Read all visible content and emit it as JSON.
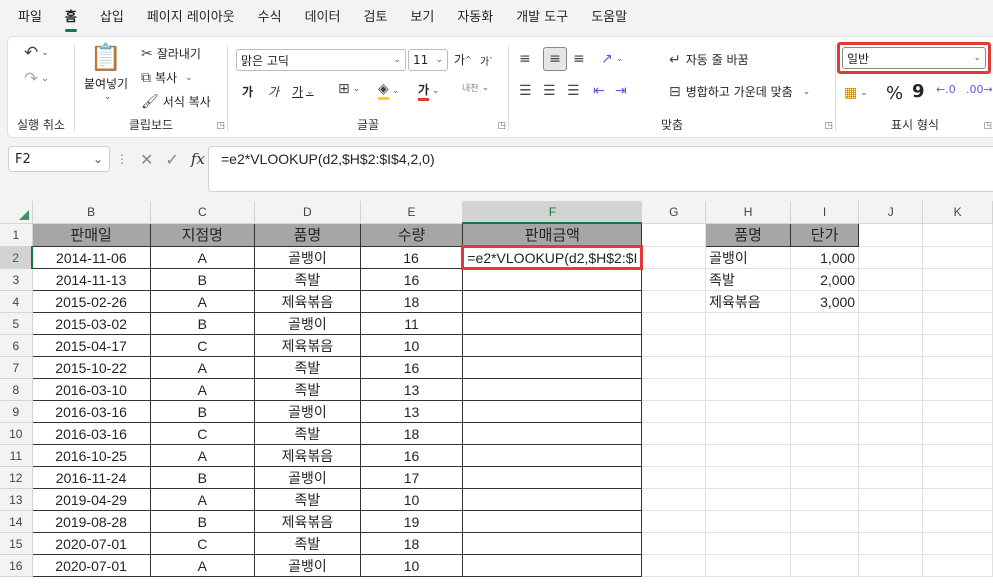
{
  "menu": {
    "tabs": [
      "파일",
      "홈",
      "삽입",
      "페이지 레이아웃",
      "수식",
      "데이터",
      "검토",
      "보기",
      "자동화",
      "개발 도구",
      "도움말"
    ],
    "active": "홈"
  },
  "ribbon": {
    "undo_label": "실행 취소",
    "clipboard": {
      "paste": "붙여넣기",
      "cut": "잘라내기",
      "copy": "복사",
      "format_painter": "서식 복사",
      "label": "클립보드"
    },
    "font": {
      "name": "맑은 고딕",
      "size": "11",
      "grow": "가",
      "shrink": "가",
      "bold": "가",
      "italic": "가",
      "underline": "가",
      "color_letter": "가",
      "phonetic": "내천",
      "label": "글꼴"
    },
    "alignment": {
      "wrap_text": "자동 줄 바꿈",
      "merge_center": "병합하고 가운데 맞춤",
      "label": "맞춤"
    },
    "number": {
      "format": "일반",
      "percent": "%",
      "comma": "9",
      "label": "표시 형식"
    }
  },
  "formula_bar": {
    "name_box": "F2",
    "fx": "fx",
    "formula": "=e2*VLOOKUP(d2,$H$2:$I$4,2,0)"
  },
  "sheet": {
    "columns": [
      "B",
      "C",
      "D",
      "E",
      "F",
      "G",
      "H",
      "I",
      "J",
      "K"
    ],
    "selected_column": "F",
    "selected_row": 2,
    "header_row": [
      "판매일",
      "지점명",
      "품명",
      "수량",
      "판매금액"
    ],
    "rows": [
      {
        "n": 2,
        "date": "2014-11-06",
        "branch": "A",
        "item": "골뱅이",
        "qty": "16"
      },
      {
        "n": 3,
        "date": "2014-11-13",
        "branch": "B",
        "item": "족발",
        "qty": "16"
      },
      {
        "n": 4,
        "date": "2015-02-26",
        "branch": "A",
        "item": "제육볶음",
        "qty": "18"
      },
      {
        "n": 5,
        "date": "2015-03-02",
        "branch": "B",
        "item": "골뱅이",
        "qty": "11"
      },
      {
        "n": 6,
        "date": "2015-04-17",
        "branch": "C",
        "item": "제육볶음",
        "qty": "10"
      },
      {
        "n": 7,
        "date": "2015-10-22",
        "branch": "A",
        "item": "족발",
        "qty": "16"
      },
      {
        "n": 8,
        "date": "2016-03-10",
        "branch": "A",
        "item": "족발",
        "qty": "13"
      },
      {
        "n": 9,
        "date": "2016-03-16",
        "branch": "B",
        "item": "골뱅이",
        "qty": "13"
      },
      {
        "n": 10,
        "date": "2016-03-16",
        "branch": "C",
        "item": "족발",
        "qty": "18"
      },
      {
        "n": 11,
        "date": "2016-10-25",
        "branch": "A",
        "item": "제육볶음",
        "qty": "16"
      },
      {
        "n": 12,
        "date": "2016-11-24",
        "branch": "B",
        "item": "골뱅이",
        "qty": "17"
      },
      {
        "n": 13,
        "date": "2019-04-29",
        "branch": "A",
        "item": "족발",
        "qty": "10"
      },
      {
        "n": 14,
        "date": "2019-08-28",
        "branch": "B",
        "item": "제육볶음",
        "qty": "19"
      },
      {
        "n": 15,
        "date": "2020-07-01",
        "branch": "C",
        "item": "족발",
        "qty": "18"
      },
      {
        "n": 16,
        "date": "2020-07-01",
        "branch": "A",
        "item": "골뱅이",
        "qty": "10"
      }
    ],
    "active_cell_text": "=e2*VLOOKUP(d2,$H$2:$I",
    "lookup": {
      "header": [
        "품명",
        "단가"
      ],
      "rows": [
        {
          "name": "골뱅이",
          "price": "1,000"
        },
        {
          "name": "족발",
          "price": "2,000"
        },
        {
          "name": "제육볶음",
          "price": "3,000"
        }
      ]
    }
  },
  "colors": {
    "accent": "#107c41",
    "highlight": "#e53935",
    "header_fill": "#a6a6a6"
  }
}
